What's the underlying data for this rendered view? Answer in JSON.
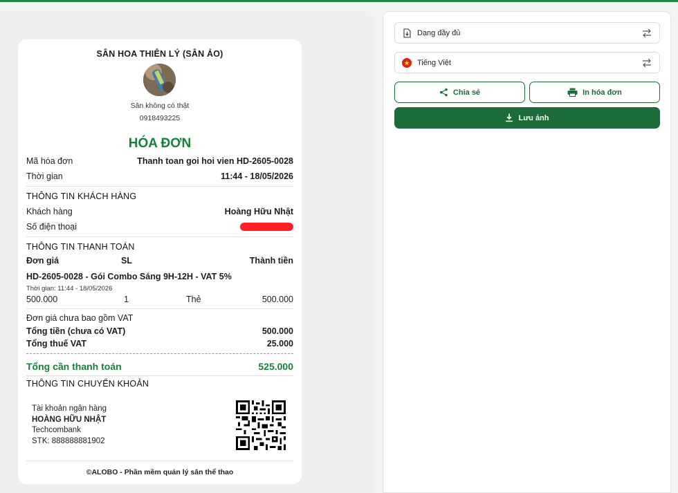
{
  "invoice": {
    "shop_name": "SÂN HOA THIÊN LÝ (SÂN ẢO)",
    "shop_subtitle": "Sân không có thật",
    "shop_phone": "0918493225",
    "title": "HÓA ĐƠN",
    "invoice_code_label": "Mã hóa đơn",
    "invoice_code_value": "Thanh toan goi hoi vien HD-2605-0028",
    "time_label": "Thời gian",
    "time_value": "11:44 - 18/05/2026",
    "customer_section": "THÔNG TIN KHÁCH HÀNG",
    "customer_label": "Khách hàng",
    "customer_value": "Hoàng Hữu Nhật",
    "phone_label": "Số điện thoại",
    "payment_section": "THÔNG TIN THANH TOÁN",
    "columns": {
      "price": "Đơn giá",
      "qty": "SL",
      "amount": "Thành tiền"
    },
    "item": {
      "name": "HD-2605-0028 - Gói Combo Sáng 9H-12H - VAT 5%",
      "time": "Thời gian: 11:44 - 18/05/2026",
      "price": "500.000",
      "qty": "1",
      "method": "Thẻ",
      "amount": "500.000"
    },
    "vat_note": "Đơn giá chưa bao gồm VAT",
    "subtotal_label": "Tổng tiền (chưa có VAT)",
    "subtotal_value": "500.000",
    "tax_label": "Tổng thuế VAT",
    "tax_value": "25.000",
    "total_label": "Tổng cần thanh toán",
    "total_value": "525.000",
    "transfer_section": "THÔNG TIN CHUYỂN KHOẢN",
    "bank": {
      "label": "Tài khoản ngân hàng",
      "holder": "HOÀNG HỮU NHẬT",
      "bank_name": "Techcombank",
      "account": "STK: 888888881902"
    },
    "footer": "©ALOBO - Phần mềm quản lý sân thể thao"
  },
  "sidebar": {
    "format_select": "Dạng đầy đủ",
    "language_select": "Tiếng Việt",
    "share_label": "Chia sẻ",
    "print_label": "In hóa đơn",
    "save_label": "Lưu ảnh"
  },
  "colors": {
    "brand_green": "#17803b",
    "button_green": "#1b6b3b",
    "redaction": "#ff1f26"
  },
  "icons": [
    "download-file-icon",
    "vietnam-flag-icon",
    "swap-icon",
    "share-icon",
    "printer-icon",
    "download-icon",
    "qr-code"
  ]
}
